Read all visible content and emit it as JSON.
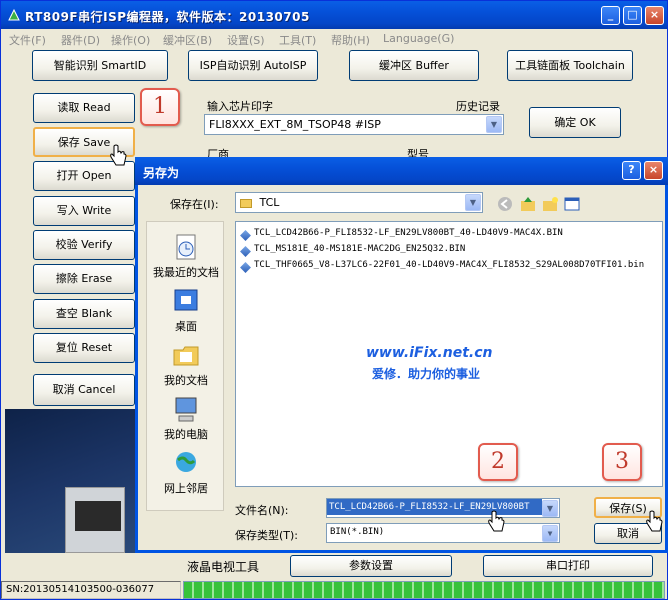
{
  "window": {
    "title": "RT809F串行ISP编程器，软件版本：20130705"
  },
  "menu": [
    "文件(F)",
    "器件(D)",
    "操作(O)",
    "缓冲区(B)",
    "设置(S)",
    "工具(T)",
    "帮助(H)",
    "Language(G)"
  ],
  "top_buttons": {
    "smartid": "智能识别 SmartID",
    "autoisp": "ISP自动识别 AutoISP",
    "buffer": "缓冲区 Buffer",
    "toolchain": "工具链面板 Toolchain"
  },
  "side_buttons": {
    "read": "读取 Read",
    "save": "保存 Save",
    "open": "打开 Open",
    "write": "写入 Write",
    "verify": "校验 Verify",
    "erase": "擦除 Erase",
    "blank": "查空 Blank",
    "reset": "复位 Reset",
    "cancel": "取消 Cancel"
  },
  "chip": {
    "input_label": "输入芯片印字",
    "history_label": "历史记录",
    "value": "FLI8XXX_EXT_8M_TSOP48 #ISP",
    "ok": "确定 OK",
    "vendor_label": "厂商",
    "model_label": "型号"
  },
  "dialog": {
    "title": "另存为",
    "save_in_label": "保存在(I):",
    "save_in_value": "TCL",
    "places": [
      "我最近的文档",
      "桌面",
      "我的文档",
      "我的电脑",
      "网上邻居"
    ],
    "files": [
      "TCL_LCD42B66-P_FLI8532-LF_EN29LV800BT_40-LD40V9-MAC4X.BIN",
      "TCL_MS181E_40-MS181E-MAC2DG_EN25Q32.BIN",
      "TCL_THF0665_V8-L37LC6-22F01_40-LD40V9-MAC4X_FLI8532_S29AL008D70TFI01.bin"
    ],
    "filename_label": "文件名(N):",
    "filename_value": "TCL_LCD42B66-P_FLI8532-LF_EN29LV800BT",
    "filetype_label": "保存类型(T):",
    "filetype_value": "BIN(*.BIN)",
    "save": "保存(S)",
    "cancel": "取消"
  },
  "watermark": {
    "line1": "www.iFix.net.cn",
    "line2": "爱修．助力你的事业"
  },
  "bottom_tabs": {
    "lcd": "液晶电视工具",
    "params": "参数设置",
    "serial": "串口打印"
  },
  "status": "SN:20130514103500-036077",
  "callouts": [
    "1",
    "2",
    "3"
  ],
  "colors": {
    "titlebar": "#0550d8",
    "callout_border": "#e25b4e",
    "watermark": "#1c5fe0",
    "progress": "#37c23b"
  }
}
